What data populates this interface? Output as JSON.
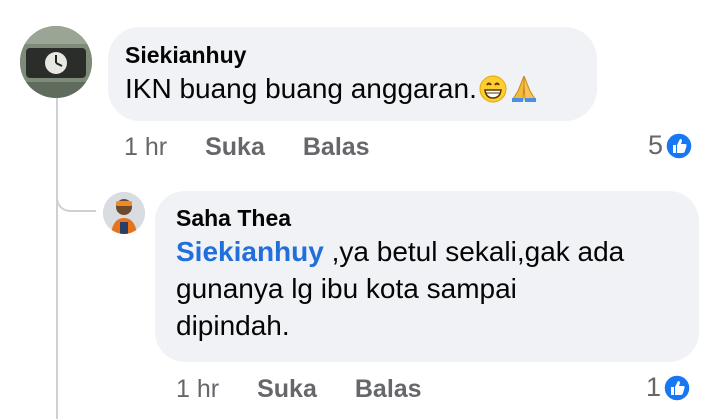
{
  "comments": [
    {
      "author": "Siekianhuy",
      "text": "IKN buang buang anggaran.",
      "emojis": [
        "grinning-face-emoji",
        "folded-hands-emoji"
      ],
      "time": "1 hr",
      "like_label": "Suka",
      "reply_label": "Balas",
      "reaction_count": "5"
    }
  ],
  "replies": [
    {
      "author": "Saha Thea",
      "mention": "Siekianhuy",
      "text_lines": [
        " ,ya betul sekali,gak ada",
        "gunanya lg ibu kota sampai",
        "dipindah."
      ],
      "time": "1 hr",
      "like_label": "Suka",
      "reply_label": "Balas",
      "reaction_count": "1"
    }
  ],
  "colors": {
    "bubble": "#f0f2f5",
    "mention": "#216fdb",
    "meta": "#65676b",
    "like_blue": "#1877f2"
  }
}
